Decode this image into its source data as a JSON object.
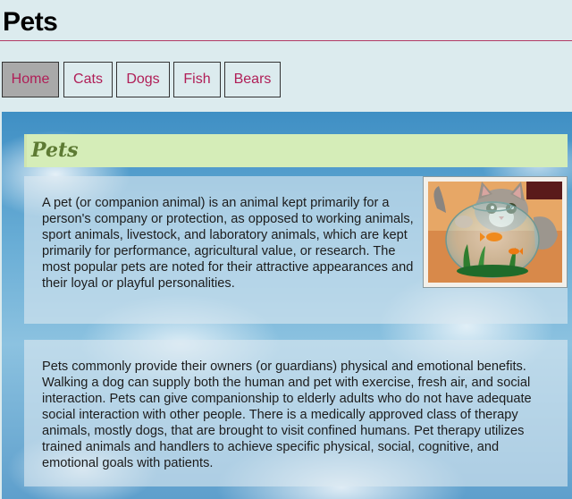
{
  "header": {
    "title": "Pets"
  },
  "nav": {
    "items": [
      {
        "label": "Home",
        "active": true
      },
      {
        "label": "Cats",
        "active": false
      },
      {
        "label": "Dogs",
        "active": false
      },
      {
        "label": "Fish",
        "active": false
      },
      {
        "label": "Bears",
        "active": false
      }
    ]
  },
  "main": {
    "heading": "Pets",
    "paragraph_1": "A pet (or companion animal) is an animal kept primarily for a person's company or protection, as opposed to working animals, sport animals, livestock, and laboratory animals, which are kept primarily for performance, agricultural value, or research. The most popular pets are noted for their attractive appearances and their loyal or playful personalities.",
    "paragraph_2": "Pets commonly provide their owners (or guardians) physical and emotional benefits. Walking a dog can supply both the human and pet with exercise, fresh air, and social interaction. Pets can give companionship to elderly adults who do not have adequate social interaction with other people. There is a medically approved class of therapy animals, mostly dogs, that are brought to visit confined humans. Pet therapy utilizes trained animals and handlers to achieve specific physical, social, cognitive, and emotional goals with patients.",
    "image": {
      "subject": "cat-behind-fishbowl-photo"
    }
  },
  "colors": {
    "nav_text": "#b01e57",
    "title_rule": "#b33b65",
    "heading_bg": "#d5edb8",
    "heading_text": "#5d7a33",
    "page_bg": "#dcebee"
  }
}
